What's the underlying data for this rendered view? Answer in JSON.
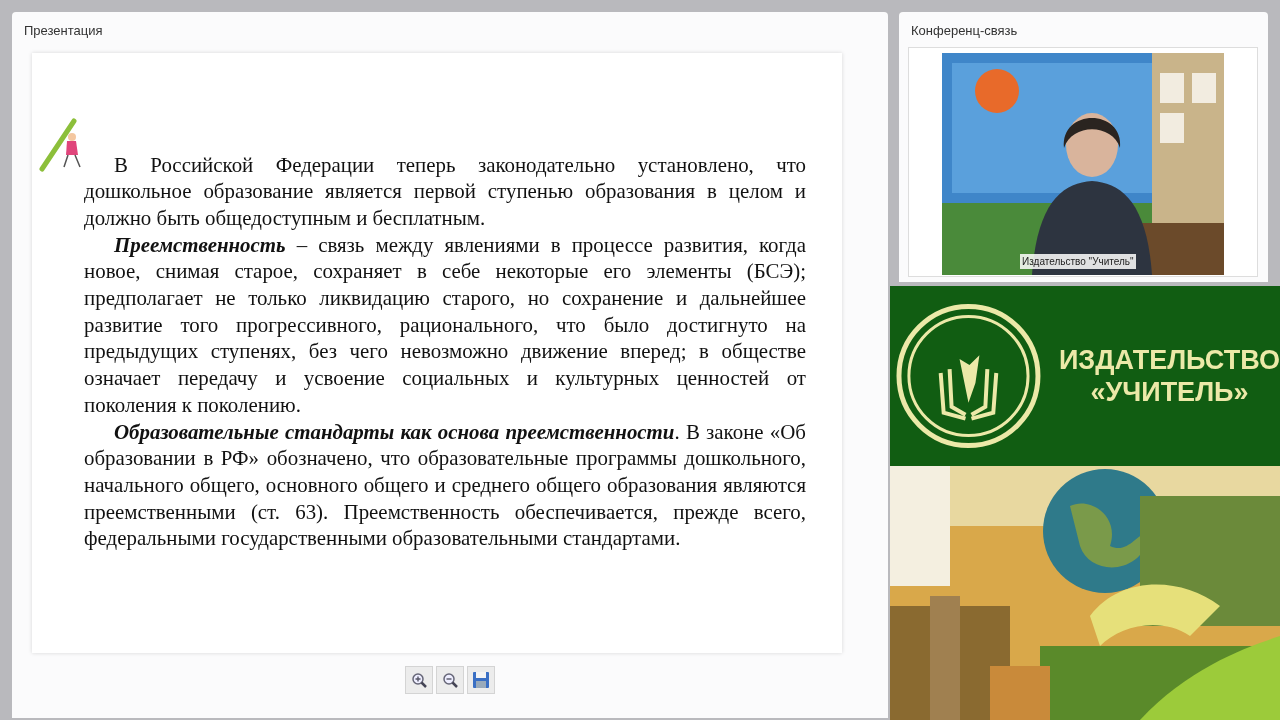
{
  "presentation": {
    "title": "Презентация",
    "paragraphs": [
      {
        "text": "В Российской Федерации теперь законодательно установлено, что дошкольное образование является первой ступенью образования в целом и должно быть общедоступным и бесплатным."
      },
      {
        "lead": "Преемственность",
        "text": " – связь между явлениями в процессе развития, когда новое, снимая старое, сохраняет в себе некоторые его элементы (БСЭ); предполагает не только ликвидацию старого, но сохранение и дальнейшее развитие того прогрессивного, рационального, что было достигнуто на предыдущих ступенях, без чего невозможно движение вперед; в обществе означает передачу и усвоение социальных и культурных ценностей от поколения к поколению."
      },
      {
        "lead": "Образовательные стандарты как основа преемственности",
        "text": ". В законе «Об образовании в РФ» обозначено, что образовательные программы дошкольного, начального общего, основного общего и среднего общего образования являются преемственными (ст. 63). Преемственность обеспечивается, прежде всего, федеральными государственными образовательными стандартами."
      }
    ],
    "toolbar": [
      {
        "kind": "zoom_in"
      },
      {
        "kind": "zoom_out"
      },
      {
        "kind": "save"
      }
    ]
  },
  "conference": {
    "title": "Конференц-связь",
    "video": {
      "kind": "picture",
      "caption": "Издательство \"Учитель\""
    }
  },
  "banner": {
    "line_1": "ИЗДАТЕЛЬСТВО",
    "line_2": "«УЧИТЕЛЬ»"
  }
}
